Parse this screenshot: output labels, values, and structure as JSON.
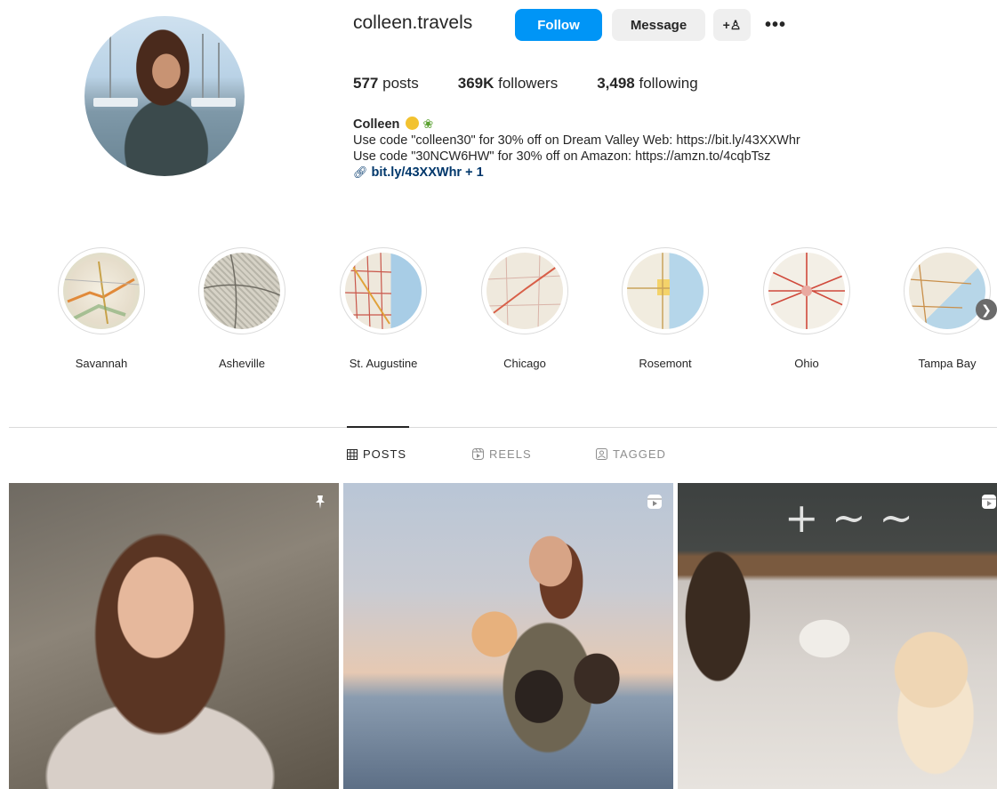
{
  "profile": {
    "username": "colleen.travels",
    "follow_label": "Follow",
    "message_label": "Message",
    "suggest_label": "+♙",
    "more_label": "•••",
    "posts_count": "577",
    "posts_label": "posts",
    "followers_count": "369K",
    "followers_label": "followers",
    "following_count": "3,498",
    "following_label": "following",
    "bio_name": "Colleen",
    "bio_line1": "Use code \"colleen30\" for 30% off on Dream Valley Web:   https://bit.ly/43XXWhr",
    "bio_line2": "Use code \"30NCW6HW\" for 30% off on Amazon: https://amzn.to/4cqbTsz",
    "link_text": "bit.ly/43XXWhr + 1"
  },
  "highlights": [
    {
      "label": "Savannah"
    },
    {
      "label": "Asheville"
    },
    {
      "label": "St. Augustine"
    },
    {
      "label": "Chicago"
    },
    {
      "label": "Rosemont"
    },
    {
      "label": "Ohio"
    },
    {
      "label": "Tampa Bay"
    }
  ],
  "tabs": {
    "posts": "POSTS",
    "reels": "REELS",
    "tagged": "TAGGED"
  },
  "posts": [
    {
      "icon": "pin-icon"
    },
    {
      "icon": "reel-icon"
    },
    {
      "icon": "reel-icon"
    }
  ],
  "colors": {
    "accent": "#0095f6",
    "link": "#00376b",
    "muted": "#8e8e8e"
  }
}
